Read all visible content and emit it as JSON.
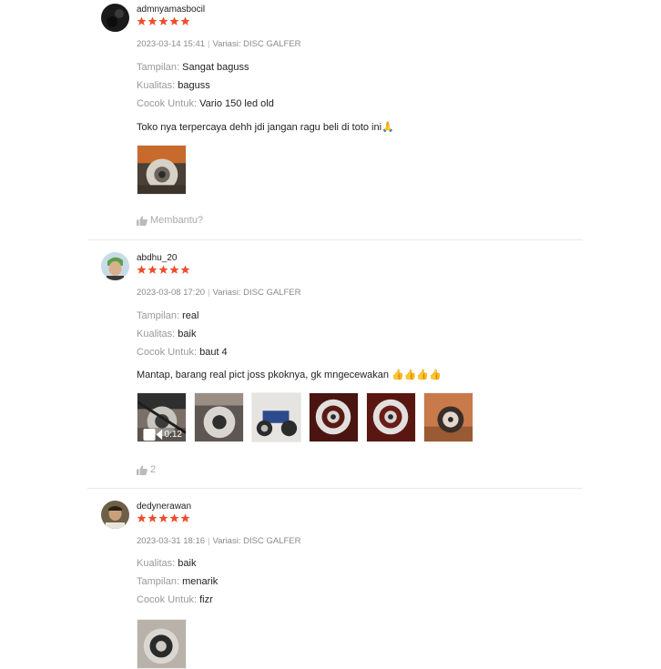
{
  "accent_color": "#ee4d2d",
  "star_icon": "star-icon",
  "helpful_icon": "thumbs-up-icon",
  "reviews": [
    {
      "username": "admnyamasbocil",
      "rating": 5,
      "date": "2023-03-14 15:41",
      "variant_label": "Variasi:",
      "variant": "DISC GALFER",
      "attributes": [
        {
          "key": "Tampilan:",
          "value": "Sangat baguss"
        },
        {
          "key": "Kualitas:",
          "value": "baguss"
        },
        {
          "key": "Cocok Untuk:",
          "value": "Vario 150 led old"
        }
      ],
      "comment": "Toko nya terpercaya dehh jdi jangan ragu beli di toto ini🙏",
      "helpful": "Membantu?"
    },
    {
      "username": "abdhu_20",
      "rating": 5,
      "date": "2023-03-08 17:20",
      "variant_label": "Variasi:",
      "variant": "DISC GALFER",
      "attributes": [
        {
          "key": "Tampilan:",
          "value": "real"
        },
        {
          "key": "Kualitas:",
          "value": "baik"
        },
        {
          "key": "Cocok Untuk:",
          "value": "baut 4"
        }
      ],
      "comment": "Mantap, barang real pict joss pkoknya, gk mngecewakan 👍👍👍👍",
      "video_duration": "0:12",
      "helpful": "2"
    },
    {
      "username": "dedynerawan",
      "rating": 5,
      "date": "2023-03-31 18:16",
      "variant_label": "Variasi:",
      "variant": "DISC GALFER",
      "attributes": [
        {
          "key": "Kualitas:",
          "value": "baik"
        },
        {
          "key": "Tampilan:",
          "value": "menarik"
        },
        {
          "key": "Cocok Untuk:",
          "value": "fizr"
        }
      ]
    }
  ]
}
